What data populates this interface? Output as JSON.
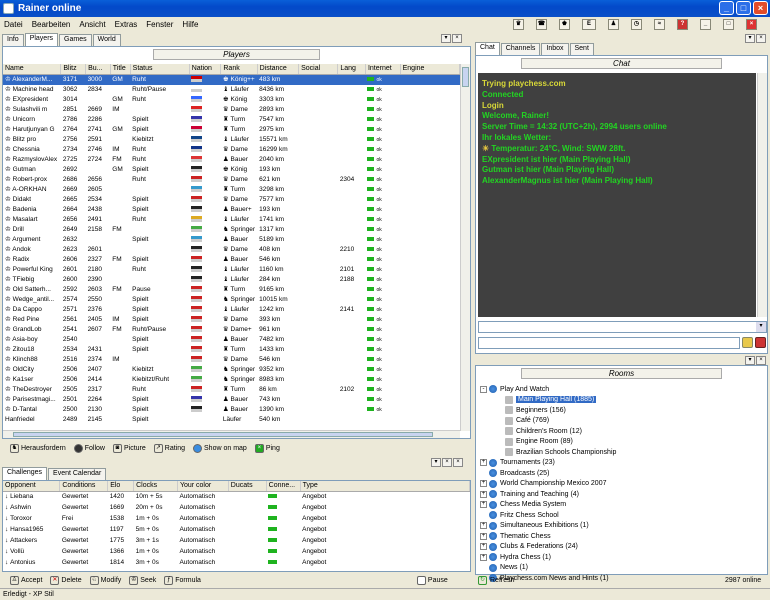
{
  "app": {
    "title": "Rainer online"
  },
  "menu": [
    "Datei",
    "Bearbeiten",
    "Ansicht",
    "Extras",
    "Fenster",
    "Hilfe"
  ],
  "toolbar_icons": [
    "queen-icon",
    "phone-icon",
    "king-icon",
    "elo-icon",
    "pawn-icon",
    "clock-icon",
    "wifi-icon",
    "help-icon",
    "minimize-icon",
    "restore-icon",
    "close-icon"
  ],
  "left_tabs": [
    "Info",
    "Players",
    "Games",
    "World"
  ],
  "players_title": "Players",
  "players_columns": [
    "Name",
    "Blitz",
    "Bu...",
    "Title",
    "Status",
    "Nation",
    "Rank",
    "Distance",
    "Social",
    "Lang",
    "Internet",
    "Engine"
  ],
  "players": [
    [
      "AlexanderM...",
      "3171",
      "3000",
      "GM",
      "Ruht",
      "#c00",
      "König++",
      "483 km",
      "",
      "",
      "ok"
    ],
    [
      "Machine head",
      "3062",
      "2834",
      "",
      "Ruht/Pause",
      "#fff",
      "Läufer",
      "8436 km",
      "",
      "",
      "ok"
    ],
    [
      "EXpresident",
      "3014",
      "",
      "GM",
      "Ruht",
      "#36f",
      "König",
      "3303 km",
      "",
      "",
      "ok"
    ],
    [
      "Sulashvili m",
      "2851",
      "2669",
      "IM",
      "",
      "#d22",
      "Dame",
      "2893 km",
      "",
      "",
      "ok"
    ],
    [
      "Unicorn",
      "2786",
      "2286",
      "",
      "Spielt",
      "#33a",
      "Turm",
      "7547 km",
      "",
      "",
      "ok"
    ],
    [
      "Harutjunyan G",
      "2764",
      "2741",
      "GM",
      "Spielt",
      "#c03",
      "Turm",
      "2975 km",
      "",
      "",
      "ok"
    ],
    [
      "Blitz pro",
      "2756",
      "2591",
      "",
      "Kiebitzt",
      "#148",
      "Läufer",
      "15571 km",
      "",
      "",
      "ok"
    ],
    [
      "Chessnia",
      "2734",
      "2746",
      "IM",
      "Ruht",
      "#138",
      "Dame",
      "16299 km",
      "",
      "",
      "ok"
    ],
    [
      "RazmyslovAlex",
      "2725",
      "2724",
      "FM",
      "Ruht",
      "#d33",
      "Bauer",
      "2040 km",
      "",
      "",
      "ok"
    ],
    [
      "Gutman",
      "2692",
      "",
      "GM",
      "Spielt",
      "#222",
      "König",
      "193 km",
      "",
      "",
      "ok"
    ],
    [
      "Robert-prox",
      "2686",
      "2656",
      "",
      "Ruht",
      "#c22",
      "Dame",
      "621 km",
      "",
      "2304",
      "ok"
    ],
    [
      "A-ORKHAN",
      "2669",
      "2605",
      "",
      "",
      "#39c",
      "Turm",
      "3298 km",
      "",
      "",
      "ok"
    ],
    [
      "Didakt",
      "2665",
      "2534",
      "",
      "Spielt",
      "#c22",
      "Dame",
      "7577 km",
      "",
      "",
      "ok"
    ],
    [
      "Badenia",
      "2664",
      "2438",
      "",
      "Spielt",
      "#222",
      "Bauer+",
      "193 km",
      "",
      "",
      "ok"
    ],
    [
      "Masalart",
      "2656",
      "2491",
      "",
      "Ruht",
      "#da2",
      "Läufer",
      "1741 km",
      "",
      "",
      "ok"
    ],
    [
      "Drill",
      "2649",
      "2158",
      "FM",
      "",
      "#4a4",
      "Springer",
      "1317 km",
      "",
      "",
      "ok"
    ],
    [
      "Argument",
      "2632",
      "",
      "",
      "Spielt",
      "#39c",
      "Bauer",
      "5189 km",
      "",
      "",
      "ok"
    ],
    [
      "Andok",
      "2623",
      "2601",
      "",
      "",
      "#222",
      "Dame",
      "408 km",
      "",
      "2210",
      "ok"
    ],
    [
      "Radix",
      "2606",
      "2327",
      "FM",
      "Spielt",
      "#c22",
      "Bauer",
      "546 km",
      "",
      "",
      "ok"
    ],
    [
      "Powerful King",
      "2601",
      "2180",
      "",
      "Ruht",
      "#222",
      "Läufer",
      "1160 km",
      "",
      "2101",
      "ok"
    ],
    [
      "TFiebig",
      "2600",
      "2390",
      "",
      "",
      "#222",
      "Läufer",
      "284 km",
      "",
      "2188",
      "ok"
    ],
    [
      "Old Satterh...",
      "2592",
      "2603",
      "FM",
      "Pause",
      "#c22",
      "Turm",
      "9165 km",
      "",
      "",
      "ok"
    ],
    [
      "Wedge_antil...",
      "2574",
      "2550",
      "",
      "Spielt",
      "#c22",
      "Springer",
      "10015 km",
      "",
      "",
      "ok"
    ],
    [
      "Da Cappo",
      "2571",
      "2376",
      "",
      "Spielt",
      "#c22",
      "Läufer",
      "1242 km",
      "",
      "2141",
      "ok"
    ],
    [
      "Red Pine",
      "2561",
      "2405",
      "IM",
      "Spielt",
      "#c22",
      "Dame",
      "393 km",
      "",
      "",
      "ok"
    ],
    [
      "GrandLob",
      "2541",
      "2607",
      "FM",
      "Ruht/Pause",
      "#c22",
      "Dame+",
      "961 km",
      "",
      "",
      "ok"
    ],
    [
      "Asia-boy",
      "2540",
      "",
      "",
      "Spielt",
      "#c22",
      "Bauer",
      "7482 km",
      "",
      "",
      "ok"
    ],
    [
      "Zitou18",
      "2534",
      "2431",
      "",
      "Spielt",
      "#c22",
      "Turm",
      "1433 km",
      "",
      "",
      "ok"
    ],
    [
      "Klinch88",
      "2516",
      "2374",
      "IM",
      "",
      "#c22",
      "Dame",
      "546 km",
      "",
      "",
      "ok"
    ],
    [
      "OldCity",
      "2506",
      "2407",
      "",
      "Kiebitzt",
      "#4a4",
      "Springer",
      "9352 km",
      "",
      "",
      "ok"
    ],
    [
      "Ka1ser",
      "2506",
      "2414",
      "",
      "Kiebitzt/Ruht",
      "#4a4",
      "Springer",
      "8983 km",
      "",
      "",
      "ok"
    ],
    [
      "TheDestroyer",
      "2505",
      "2317",
      "",
      "Ruht",
      "#c22",
      "Turm",
      "86 km",
      "",
      "2102",
      "ok"
    ],
    [
      "Parisestmagi...",
      "2501",
      "2264",
      "",
      "Spielt",
      "#33a",
      "Bauer",
      "743 km",
      "",
      "",
      "ok"
    ],
    [
      "D-Tantal",
      "2500",
      "2130",
      "",
      "Spielt",
      "#222",
      "Bauer",
      "1390 km",
      "",
      "",
      "ok"
    ]
  ],
  "players_partial_row": [
    "Hanfriedel",
    "2489",
    "2145",
    "",
    "Spielt",
    "",
    "Läufer",
    "540 km"
  ],
  "player_buttons": [
    "Herausfordern",
    "Follow",
    "Picture",
    "Rating",
    "Show on map",
    "Ping"
  ],
  "bottom_tabs": [
    "Challenges",
    "Event Calendar"
  ],
  "challenge_columns": [
    "Opponent",
    "Conditions",
    "Elo",
    "Clocks",
    "Your color",
    "Ducats",
    "Conne...",
    "Type"
  ],
  "challenges": [
    [
      "Liebana",
      "Gewertet",
      "1420",
      "10m + 5s",
      "Automatisch",
      "",
      "Angebot"
    ],
    [
      "Ashwin",
      "Gewertet",
      "1669",
      "20m + 0s",
      "Automatisch",
      "",
      "Angebot"
    ],
    [
      "Toroxor",
      "Frei",
      "1538",
      "1m + 0s",
      "Automatisch",
      "",
      "Angebot"
    ],
    [
      "Hansa1965",
      "Gewertet",
      "1197",
      "5m + 0s",
      "Automatisch",
      "",
      "Angebot"
    ],
    [
      "Attackers",
      "Gewertet",
      "1775",
      "3m + 1s",
      "Automatisch",
      "",
      "Angebot"
    ],
    [
      "Vollü",
      "Gewertet",
      "1366",
      "1m + 0s",
      "Automatisch",
      "",
      "Angebot"
    ],
    [
      "Antonius",
      "Gewertet",
      "1814",
      "3m + 0s",
      "Automatisch",
      "",
      "Angebot"
    ]
  ],
  "challenge_buttons": [
    "Accept",
    "Delete",
    "Modify",
    "Seek",
    "Formula"
  ],
  "pause_label": "Pause",
  "right_tabs": [
    "Chat",
    "Channels",
    "Inbox",
    "Sent"
  ],
  "chat_title": "Chat",
  "chat_lines": [
    "Trying playchess.com",
    "Connected",
    "Login",
    "Welcome, Rainer!",
    "Server Time = 14:32 (UTC+2h), 2994 users online",
    "Ihr lokales Wetter:",
    "Temperatur: 24°C, Wind: SWW 28ft.",
    "EXpresident ist hier (Main Playing Hall)",
    "Gutman ist hier (Main Playing Hall)",
    "AlexanderMagnus ist hier (Main Playing Hall)"
  ],
  "rooms_title": "Rooms",
  "rooms": [
    {
      "level": 0,
      "exp": "-",
      "label": "Play And Watch"
    },
    {
      "level": 1,
      "exp": "",
      "label": "Main Playing Hall  (1885)",
      "selected": true
    },
    {
      "level": 1,
      "exp": "",
      "label": "Beginners  (156)"
    },
    {
      "level": 1,
      "exp": "",
      "label": "Café  (769)"
    },
    {
      "level": 1,
      "exp": "",
      "label": "Children's Room  (12)"
    },
    {
      "level": 1,
      "exp": "",
      "label": "Engine Room  (89)"
    },
    {
      "level": 1,
      "exp": "",
      "label": "Brazilian Schools Championship"
    },
    {
      "level": 0,
      "exp": "+",
      "label": "Tournaments  (23)"
    },
    {
      "level": 0,
      "exp": "",
      "label": "Broadcasts  (25)"
    },
    {
      "level": 0,
      "exp": "+",
      "label": "World Championship Mexico 2007"
    },
    {
      "level": 0,
      "exp": "+",
      "label": "Training and Teaching  (4)"
    },
    {
      "level": 0,
      "exp": "+",
      "label": "Chess Media System"
    },
    {
      "level": 0,
      "exp": "",
      "label": "Fritz Chess School"
    },
    {
      "level": 0,
      "exp": "+",
      "label": "Simultaneous Exhibitions  (1)"
    },
    {
      "level": 0,
      "exp": "+",
      "label": "Thematic Chess"
    },
    {
      "level": 0,
      "exp": "+",
      "label": "Clubs & Federations  (24)"
    },
    {
      "level": 0,
      "exp": "+",
      "label": "Hydra Chess  (1)"
    },
    {
      "level": 0,
      "exp": "",
      "label": "News  (1)"
    },
    {
      "level": 0,
      "exp": "",
      "label": "Playchess.com News and Hints  (1)"
    }
  ],
  "refresh_label": "Refresh",
  "online_count": "2987 online",
  "status_text": "Erledigt - XP Stil"
}
